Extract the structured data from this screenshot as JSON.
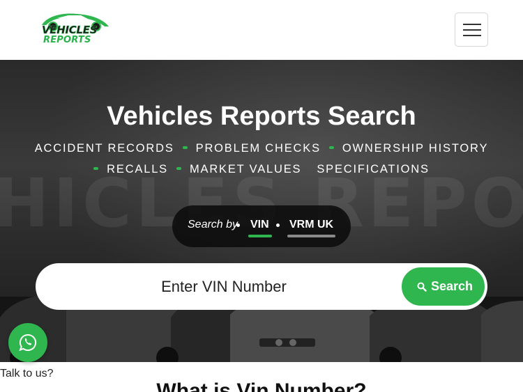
{
  "header": {
    "logo": {
      "line1": "VEHICLES",
      "line2": "REPORTS"
    },
    "menu_button": "menu"
  },
  "hero": {
    "title": "Vehicles Reports Search",
    "watermark": "HICLES REPO",
    "features_row1": [
      "ACCIDENT RECORDS",
      "PROBLEM CHECKS",
      "OWNERSHIP HISTORY"
    ],
    "features_row2": [
      "RECALLS",
      "MARKET VALUES",
      "SPECIFICATIONS"
    ],
    "search_by": {
      "label": "Search by",
      "options": [
        "VIN",
        "VRM UK"
      ],
      "selected": "VIN"
    },
    "search": {
      "placeholder": "Enter VIN Number",
      "value": "",
      "button_label": "Search",
      "button_icon": "search-icon"
    }
  },
  "chat": {
    "icon": "whatsapp-icon",
    "label": "Talk to us?"
  },
  "section": {
    "title": "What is Vin Number?"
  },
  "colors": {
    "accent": "#2fb64f",
    "hero_bg": "#2b2b2b",
    "text_dark": "#222222"
  }
}
